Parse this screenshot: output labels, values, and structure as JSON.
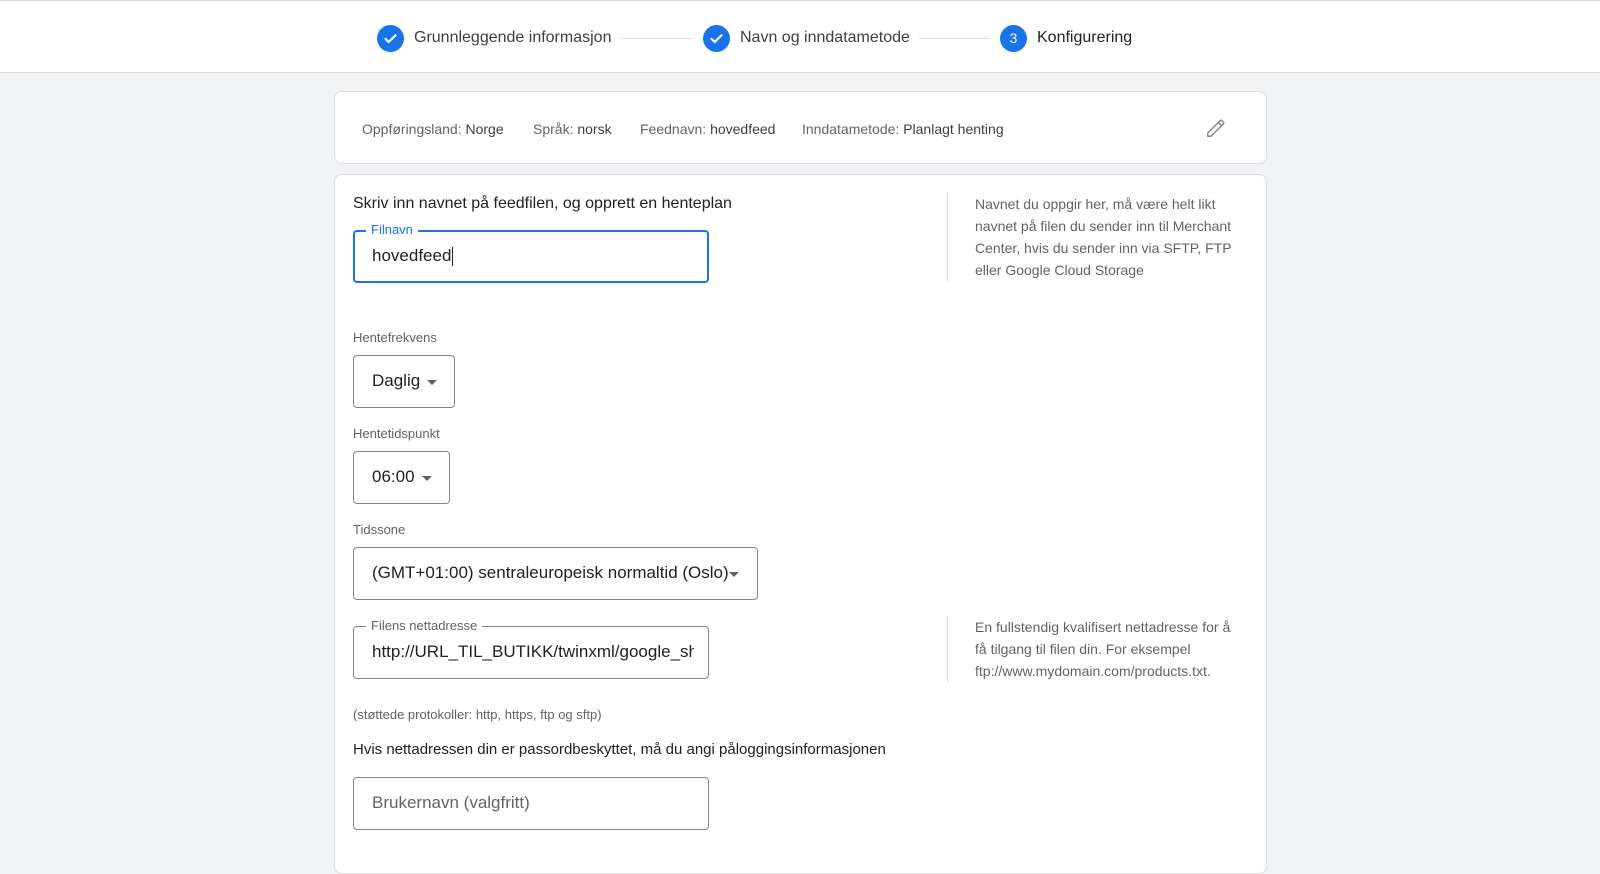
{
  "stepper": {
    "steps": [
      {
        "label": "Grunnleggende informasjon",
        "state": "completed",
        "icon": "check-icon"
      },
      {
        "label": "Navn og inndatametode",
        "state": "completed",
        "icon": "check-icon"
      },
      {
        "label": "Konfigurering",
        "state": "active",
        "number": "3"
      }
    ]
  },
  "summary": {
    "country_label": "Oppføringsland:",
    "country_value": "Norge",
    "language_label": "Språk:",
    "language_value": "norsk",
    "feed_label": "Feednavn:",
    "feed_value": "hovedfeed",
    "method_label": "Inndatametode:",
    "method_value": "Planlagt henting",
    "edit_icon": "pencil-icon"
  },
  "form": {
    "section_title": "Skriv inn navnet på feedfilen, og opprett en henteplan",
    "filename": {
      "label": "Filnavn",
      "value": "hovedfeed"
    },
    "filename_help": "Navnet du oppgir her, må være helt likt navnet på filen du sender inn til Merchant Center, hvis du sender inn via SFTP, FTP eller Google Cloud Storage",
    "frequency": {
      "label": "Hentefrekvens",
      "value": "Daglig"
    },
    "time": {
      "label": "Hentetidspunkt",
      "value": "06:00"
    },
    "timezone": {
      "label": "Tidssone",
      "value": "(GMT+01:00) sentraleuropeisk normaltid (Oslo)"
    },
    "url": {
      "label": "Filens nettadresse",
      "value": "http://URL_TIL_BUTIKK/twinxml/google_sh"
    },
    "url_help": "En fullstendig kvalifisert nettadresse for å få tilgang til filen din. For eksempel ftp://www.mydomain.com/products.txt.",
    "protocols_hint": "(støttede protokoller: http, https, ftp og sftp)",
    "credentials_title": "Hvis nettadressen din er passordbeskyttet, må du angi påloggingsinformasjonen",
    "username": {
      "placeholder": "Brukernavn (valgfritt)",
      "value": ""
    }
  },
  "colors": {
    "accent": "#1a73e8",
    "border": "#dadce0",
    "muted_text": "#5f6368"
  }
}
